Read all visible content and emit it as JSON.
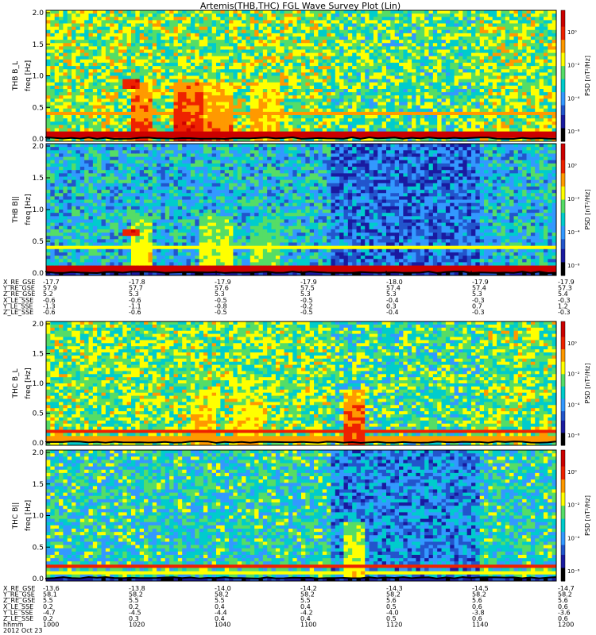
{
  "title": "Artemis(THB,THC) FGL Wave Survey Plot (Lin)",
  "chart_data": {
    "type": "heatmap",
    "colormap": [
      "#000000",
      "#1a1aa0",
      "#2255cc",
      "#3399ff",
      "#00cccc",
      "#55dd66",
      "#ffff00",
      "#ff9900",
      "#ee2200",
      "#cc0000"
    ],
    "panels": [
      {
        "ylabel": "THB B_L",
        "yunit": "freq [Hz]",
        "yticks": [
          "2.0",
          "1.5",
          "1.0",
          "0.5",
          "0.0"
        ],
        "ylim": [
          0,
          2
        ],
        "cbar_label": "PSD [nT²/Hz]",
        "cbar_ticks": [
          "10⁰",
          "10⁻²",
          "10⁻⁴",
          "10⁻⁶"
        ],
        "base": 0.58,
        "ncol": 120,
        "nrow": 40,
        "bursts": [
          [
            0.16,
            0.2,
            0.85
          ],
          [
            0.25,
            0.3,
            0.9
          ],
          [
            0.3,
            0.36,
            0.8
          ],
          [
            0.4,
            0.45,
            0.75
          ]
        ],
        "lines": [
          [
            0.12,
            0.95
          ],
          [
            0.45,
            0.7
          ]
        ],
        "dark_zone": 0.0,
        "hot_spot": [
          0.15,
          0.18,
          0.75,
          0.85
        ]
      },
      {
        "ylabel": "THB B||",
        "yunit": "freq [Hz]",
        "yticks": [
          "2.0",
          "1.5",
          "1.0",
          "0.5",
          "0.0"
        ],
        "ylim": [
          0,
          2
        ],
        "cbar_label": "PSD [nT²/Hz]",
        "cbar_ticks": [
          "10⁰",
          "10⁻²",
          "10⁻⁴",
          "10⁻⁶"
        ],
        "base": 0.42,
        "ncol": 120,
        "nrow": 40,
        "bursts": [
          [
            0.16,
            0.2,
            0.7
          ],
          [
            0.3,
            0.36,
            0.68
          ],
          [
            0.4,
            0.45,
            0.62
          ]
        ],
        "lines": [
          [
            0.12,
            0.9
          ],
          [
            0.45,
            0.62
          ]
        ],
        "dark_zone": 0.12,
        "hot_spot": [
          0.15,
          0.18,
          0.65,
          0.72
        ]
      },
      {
        "ylabel": "THC B_L",
        "yunit": "freq [Hz]",
        "yticks": [
          "2.0",
          "1.5",
          "1.0",
          "0.5",
          "0.0"
        ],
        "ylim": [
          0,
          2
        ],
        "cbar_label": "PSD [nT²/Hz]",
        "cbar_ticks": [
          "10⁰",
          "10⁻²",
          "10⁻⁴",
          "10⁻⁶"
        ],
        "base": 0.56,
        "ncol": 120,
        "nrow": 40,
        "bursts": [
          [
            0.28,
            0.33,
            0.75
          ],
          [
            0.36,
            0.42,
            0.72
          ],
          [
            0.58,
            0.62,
            0.85
          ]
        ],
        "lines": [
          [
            0.24,
            0.82
          ],
          [
            0.12,
            0.7
          ]
        ],
        "dark_zone": 0.0,
        "hot_spot": [
          0,
          0,
          0,
          0
        ]
      },
      {
        "ylabel": "THC B||",
        "yunit": "freq [Hz]",
        "yticks": [
          "2.0",
          "1.5",
          "1.0",
          "0.5",
          "0.0"
        ],
        "ylim": [
          0,
          2
        ],
        "cbar_label": "PSD [nT²/Hz]",
        "cbar_ticks": [
          "10⁰",
          "10⁻²",
          "10⁻⁴",
          "10⁻⁶"
        ],
        "base": 0.47,
        "ncol": 120,
        "nrow": 40,
        "bursts": [
          [
            0.58,
            0.62,
            0.7
          ]
        ],
        "lines": [
          [
            0.24,
            0.8
          ],
          [
            0.14,
            0.62
          ]
        ],
        "dark_zone": 0.05,
        "hot_spot": [
          0,
          0,
          0,
          0
        ]
      }
    ],
    "ephem_top": {
      "labels": [
        "X_RE_GSE",
        "Y_RE_GSE",
        "Z_RE_GSE",
        "X_LE_SSE",
        "Y_LE_SSE",
        "Z_LE_SSE"
      ],
      "columns": [
        [
          "-17.7",
          "57.9",
          "5.2",
          "-0.6",
          "-1.3",
          "-0.6"
        ],
        [
          "-17.8",
          "57.7",
          "5.3",
          "-0.6",
          "-1.1",
          "-0.6"
        ],
        [
          "-17.9",
          "57.6",
          "5.3",
          "-0.5",
          "-0.8",
          "-0.5"
        ],
        [
          "-17.9",
          "57.5",
          "5.3",
          "-0.5",
          "-0.2",
          "-0.5"
        ],
        [
          "-18.0",
          "57.4",
          "5.3",
          "-0.4",
          "0.3",
          "-0.4"
        ],
        [
          "-17.9",
          "57.4",
          "5.3",
          "-0.3",
          "0.7",
          "-0.3"
        ],
        [
          "-17.9",
          "57.3",
          "5.4",
          "-0.3",
          "1.2",
          "-0.3"
        ]
      ]
    },
    "ephem_bottom": {
      "labels": [
        "X_RE_GSE",
        "Y_RE_GSE",
        "Z_RE_GSE",
        "X_LE_SSE",
        "Y_LE_SSE",
        "Z_LE_SSE",
        "hhmm",
        "2012 Oct 23"
      ],
      "columns": [
        [
          "-13.6",
          "58.1",
          "5.5",
          "0.2",
          "-4.7",
          "0.2",
          "1000"
        ],
        [
          "-13.8",
          "58.2",
          "5.5",
          "0.2",
          "-4.5",
          "0.3",
          "1020"
        ],
        [
          "-14.0",
          "58.2",
          "5.5",
          "0.4",
          "-4.4",
          "0.4",
          "1040"
        ],
        [
          "-14.2",
          "58.2",
          "5.5",
          "0.4",
          "-4.2",
          "0.4",
          "1100"
        ],
        [
          "-14.3",
          "58.2",
          "5.6",
          "0.5",
          "-4.0",
          "0.5",
          "1120"
        ],
        [
          "-14.5",
          "58.2",
          "5.6",
          "0.6",
          "-3.8",
          "0.6",
          "1140"
        ],
        [
          "-14.7",
          "58.2",
          "5.6",
          "0.6",
          "-3.6",
          "0.6",
          "1200"
        ]
      ]
    }
  }
}
